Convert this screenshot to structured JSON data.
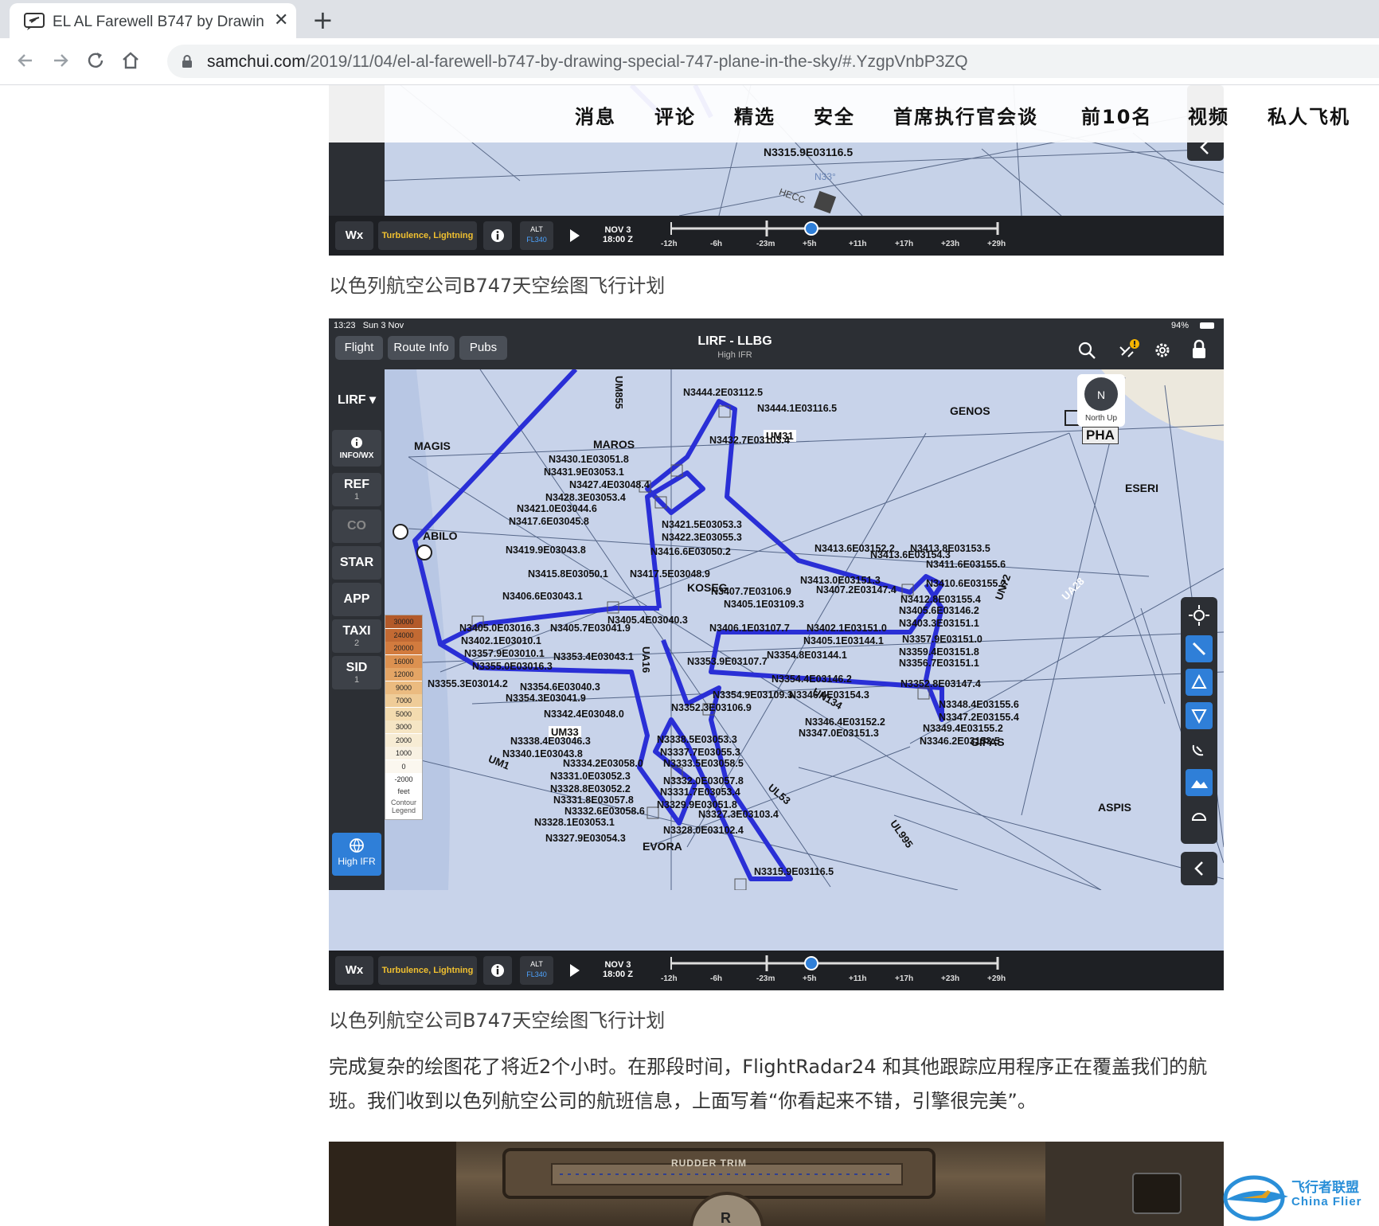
{
  "browser": {
    "tab_title": "EL AL Farewell B747 by Drawin",
    "tab_close": "✕",
    "new_tab": "+",
    "url_host": "samchui.com",
    "url_path": "/2019/11/04/el-al-farewell-b747-by-drawing-special-747-plane-in-the-sky/#.YzgpVnbP3ZQ"
  },
  "site_nav": {
    "items": [
      "消息",
      "评论",
      "精选",
      "安全",
      "首席执行官会谈",
      "前10名",
      "视频",
      "私人飞机"
    ]
  },
  "map_top": {
    "labels": [
      "N3315.9E03116.5",
      "N33°",
      "HECC"
    ],
    "timeline": {
      "wx": "Wx",
      "turbulence": "Turbulence, Lightning",
      "alt_label": "ALT",
      "alt_value": "FL340",
      "date": "NOV 3",
      "time": "18:00 Z",
      "ticks": [
        "-12h",
        "-6h",
        "-23m",
        "+5h",
        "+11h",
        "+17h",
        "+23h",
        "+29h"
      ]
    }
  },
  "caption1": "以色列航空公司B747天空绘图飞行计划",
  "map_main": {
    "status_time": "13:23",
    "status_date": "Sun 3 Nov",
    "battery": "94%",
    "tabs": [
      "Flight",
      "Route Info",
      "Pubs"
    ],
    "route_title": "LIRF - LLBG",
    "route_subtitle": "High IFR",
    "side_menu": [
      {
        "label": "LIRF ▾",
        "sub": ""
      },
      {
        "label": "INFO/WX",
        "sub": ""
      },
      {
        "label": "REF",
        "sub": "1"
      },
      {
        "label": "CO",
        "sub": ""
      },
      {
        "label": "STAR",
        "sub": ""
      },
      {
        "label": "APP",
        "sub": ""
      },
      {
        "label": "TAXI",
        "sub": "2"
      },
      {
        "label": "SID",
        "sub": "1"
      }
    ],
    "high_ifr_button": "High IFR",
    "north_up": "North Up",
    "north_letter": "N",
    "contour_legend": {
      "values": [
        "30000",
        "24000",
        "20000",
        "16000",
        "12000",
        "9000",
        "7000",
        "5000",
        "3000",
        "2000",
        "1000",
        "0",
        "-2000"
      ],
      "unit": "feet",
      "title": "Contour Legend"
    },
    "waypoints": [
      "MAGIS",
      "ABILO",
      "MAROS",
      "GENOS",
      "ESERI",
      "KOSEG",
      "GIPAS",
      "ASPIS",
      "EVORA",
      "PHA"
    ],
    "airways": [
      "UM855",
      "UM31",
      "UA16",
      "UN134",
      "UL53",
      "UL995",
      "UM1",
      "UM33",
      "UA28",
      "UN72"
    ],
    "coordinates": [
      "N3444.2E03112.5",
      "N3444.1E03116.5",
      "N3432.7E03103.4",
      "N3430.1E03051.8",
      "N3431.9E03053.1",
      "N3427.4E03048.4",
      "N3428.3E03053.4",
      "N3421.0E03044.6",
      "N3417.6E03045.8",
      "N3421.5E03053.3",
      "N3422.3E03055.3",
      "N3419.9E03043.8",
      "N3416.6E03050.2",
      "N3415.8E03050.1",
      "N3417.5E03048.9",
      "N3406.6E03043.1",
      "N3405.4E03040.3",
      "N3405.0E03016.3",
      "N3405.7E03041.9",
      "N3402.1E03010.1",
      "N3357.9E03010.1",
      "N3353.4E03043.1",
      "N3355.0E03016.3",
      "N3355.3E03014.2",
      "N3354.6E03040.3",
      "N3354.3E03041.9",
      "N3342.4E03048.0",
      "N3338.4E03046.3",
      "N3340.1E03043.8",
      "N3334.2E03058.0",
      "N3331.0E03052.3",
      "N3328.8E03052.2",
      "N3331.8E03057.8",
      "N3332.6E03058.6",
      "N3328.1E03053.1",
      "N3327.9E03054.3",
      "N3328.0E03102.4",
      "N3327.3E03103.4",
      "N3329.9E03051.8",
      "N3331.7E03053.4",
      "N3332.0E03057.8",
      "N3333.5E03058.5",
      "N3337.7E03055.3",
      "N3338.5E03053.3",
      "N3352.3E03106.9",
      "N3354.9E03109.3",
      "N3353.9E03107.7",
      "N3354.4E03146.2",
      "N3354.8E03144.1",
      "N3406.1E03107.7",
      "N3405.1E03109.3",
      "N3407.7E03106.9",
      "N3402.1E03151.0",
      "N3405.1E03144.1",
      "N3407.2E03147.4",
      "N3413.0E03151.3",
      "N3413.6E03152.2",
      "N3413.8E03153.5",
      "N3413.6E03154.3",
      "N3411.6E03155.6",
      "N3410.6E03155.2",
      "N3412.8E03155.4",
      "N3405.6E03146.2",
      "N3403.3E03151.1",
      "N3357.9E03151.0",
      "N3359.4E03151.8",
      "N3356.7E03151.1",
      "N3352.8E03147.4",
      "N3346.4E03154.3",
      "N3348.4E03155.6",
      "N3347.2E03155.4",
      "N3349.4E03155.2",
      "N3346.2E03153.5",
      "N3346.4E03152.2",
      "N3347.0E03151.3",
      "N3315.9E03116.5"
    ],
    "timeline": {
      "wx": "Wx",
      "turbulence": "Turbulence, Lightning",
      "alt_label": "ALT",
      "alt_value": "FL340",
      "date": "NOV 3",
      "time": "18:00 Z",
      "ticks": [
        "-12h",
        "-6h",
        "-23m",
        "+5h",
        "+11h",
        "+17h",
        "+23h",
        "+29h"
      ]
    }
  },
  "caption2": "以色列航空公司B747天空绘图飞行计划",
  "paragraph": "完成复杂的绘图花了将近2个小时。在那段时间，FlightRadar24 和其他跟踪应用程序正在覆盖我们的航班。我们收到以色列航空公司的航班信息，上面写着“你看起来不错，引擎很完美”。",
  "cockpit": {
    "label": "RUDDER TRIM",
    "letter": "R"
  },
  "watermark": {
    "zh": "飞行者联盟",
    "en": "China Flier"
  },
  "colors": {
    "route": "#2a2fd6",
    "map_bg": "#c8d3ea",
    "accent_blue": "#2f7fd8"
  }
}
